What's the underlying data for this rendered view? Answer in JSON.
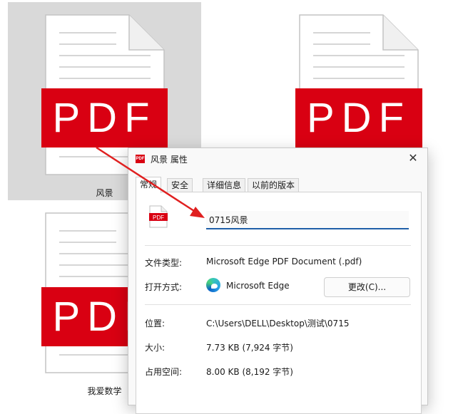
{
  "files": [
    {
      "name": "风景",
      "badge": "PDF",
      "selected": true
    },
    {
      "name": "",
      "badge": "PDF",
      "selected": false
    },
    {
      "name": "我爱数学",
      "badge": "PDF",
      "selected": false
    }
  ],
  "dialog": {
    "title": "风景 属性",
    "title_icon_text": "PDF",
    "close_glyph": "✕",
    "tabs": [
      "常规",
      "安全",
      "详细信息",
      "以前的版本"
    ],
    "active_tab": "常规",
    "file_icon_text": "PDF",
    "filename_value": "0715风景",
    "rows": {
      "type_label": "文件类型:",
      "type_value": "Microsoft Edge PDF Document (.pdf)",
      "open_label": "打开方式:",
      "open_value": "Microsoft Edge",
      "change_button": "更改(C)...",
      "location_label": "位置:",
      "location_value": "C:\\Users\\DELL\\Desktop\\测试\\0715",
      "size_label": "大小:",
      "size_value": "7.73 KB (7,924 字节)",
      "disk_label": "占用空间:",
      "disk_value": "8.00 KB (8,192 字节)"
    }
  },
  "colors": {
    "pdf_red": "#d90012",
    "annotation_arrow": "#e02020",
    "input_accent": "#1f5fa8"
  }
}
